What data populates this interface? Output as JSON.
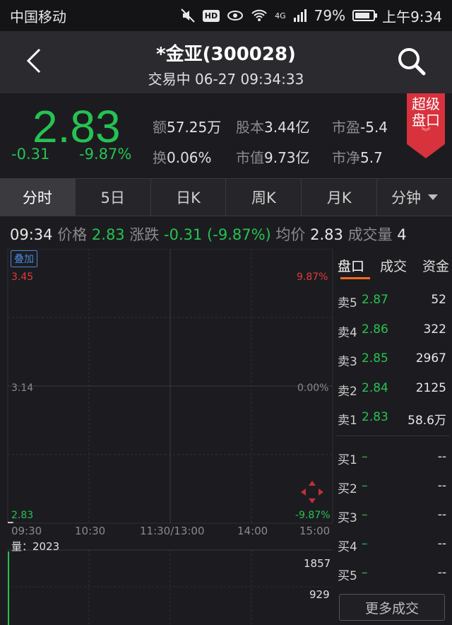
{
  "status_bar": {
    "carrier": "中国移动",
    "hd": "HD",
    "network": "4G",
    "battery": "79%",
    "time": "上午9:34"
  },
  "header": {
    "title": "*金亚(300028)",
    "subtitle": "交易中 06-27 09:34:33"
  },
  "quote": {
    "price": "2.83",
    "change": "-0.31",
    "change_pct": "-9.87%",
    "stats": [
      {
        "label": "额",
        "value": "57.25万"
      },
      {
        "label": "股本",
        "value": "3.44亿"
      },
      {
        "label": "市盈",
        "value": "-5.4"
      },
      {
        "label": "换",
        "value": "0.06%"
      },
      {
        "label": "市值",
        "value": "9.73亿"
      },
      {
        "label": "市净",
        "value": "5.7"
      }
    ],
    "super_button": {
      "line1": "超级",
      "line2": "盘口",
      "chevron": "︾"
    }
  },
  "tabs": [
    "分时",
    "5日",
    "日K",
    "周K",
    "月K",
    "分钟"
  ],
  "info_line": {
    "time": "09:34",
    "price_label": "价格",
    "price": "2.83",
    "chg_label": "涨跌",
    "chg": "-0.31 (-9.87%)",
    "avg_label": "均价",
    "avg": "2.83",
    "vol_label": "成交量",
    "vol": "4"
  },
  "chart": {
    "overlay_button": "叠加",
    "y_left": [
      "3.45",
      "3.14",
      "2.83"
    ],
    "y_right": [
      "9.87%",
      "0.00%",
      "-9.87%"
    ],
    "x_labels": [
      "09:30",
      "10:30",
      "11:30/13:00",
      "14:00",
      "15:00"
    ],
    "volume_label": "量：2023",
    "volume_ticks": [
      "1857",
      "929"
    ]
  },
  "chart_data": {
    "type": "line",
    "x": [
      "09:30",
      "09:34"
    ],
    "series": [
      {
        "values": [
          2.83,
          2.83
        ]
      }
    ],
    "ylim": [
      2.83,
      3.45
    ],
    "volume": {
      "values": [
        2023
      ]
    }
  },
  "order_book": {
    "tabs": [
      "盘口",
      "成交",
      "资金"
    ],
    "asks": [
      {
        "label": "卖5",
        "price": "2.87",
        "volume": "52"
      },
      {
        "label": "卖4",
        "price": "2.86",
        "volume": "322"
      },
      {
        "label": "卖3",
        "price": "2.85",
        "volume": "2967"
      },
      {
        "label": "卖2",
        "price": "2.84",
        "volume": "2125"
      },
      {
        "label": "卖1",
        "price": "2.83",
        "volume": "58.6万"
      }
    ],
    "bids": [
      {
        "label": "买1",
        "price": "–",
        "volume": "--"
      },
      {
        "label": "买2",
        "price": "–",
        "volume": "--"
      },
      {
        "label": "买3",
        "price": "–",
        "volume": "--"
      },
      {
        "label": "买4",
        "price": "–",
        "volume": "--"
      },
      {
        "label": "买5",
        "price": "–",
        "volume": "--"
      }
    ],
    "more_button": "更多成交"
  },
  "colors": {
    "down": "#26c252",
    "up": "#e23a3a",
    "accent": "#ff6a1a",
    "link": "#4b87d8"
  }
}
